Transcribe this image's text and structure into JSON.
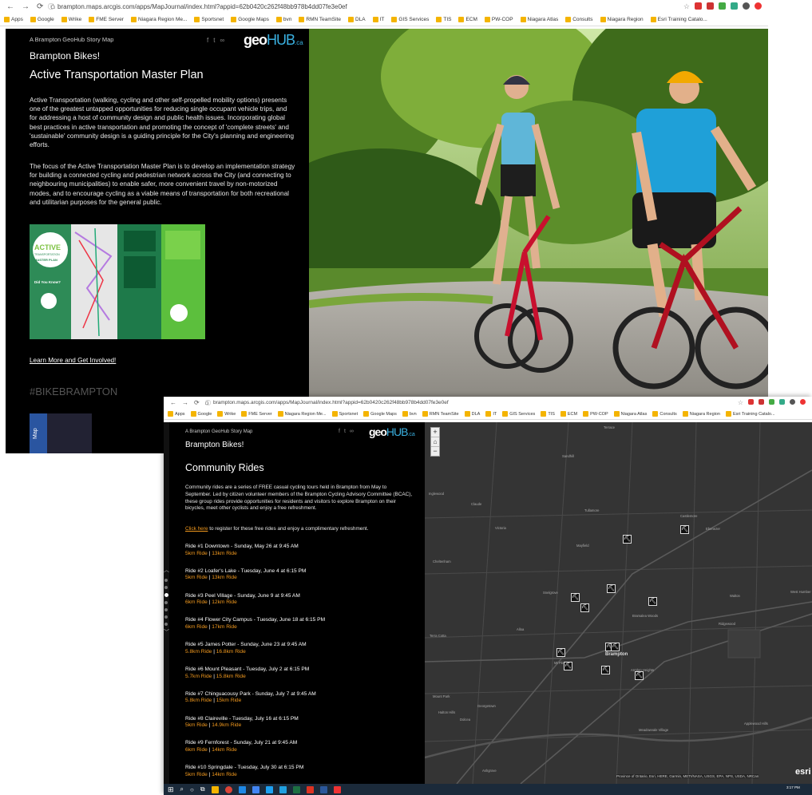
{
  "window1": {
    "url": "brampton.maps.arcgis.com/apps/MapJournal/index.html?appid=62b0420c262f48bb978b4dd07fe3e0ef",
    "bookmarks": [
      "Apps",
      "Google",
      "Wrike",
      "FME Server",
      "Niagara Region Me...",
      "Sportsnet",
      "Google Maps",
      "bvn",
      "RMN TeamSite",
      "DLA",
      "IT",
      "GIS Services",
      "TIS",
      "ECM",
      "PW-COP",
      "Niagara Atlas",
      "Consults",
      "Niagara Region",
      "Esri Training Catalo..."
    ],
    "panel": {
      "kicker": "A Brampton GeoHub Story Map",
      "app_title": "Brampton Bikes!",
      "logo_text_a": "geo",
      "logo_text_b": "HUB",
      "logo_text_c": ".ca",
      "section_title": "Active Transportation Master Plan",
      "para1": "Active Transportation (walking, cycling and other self-propelled mobility options) presents one of the greatest untapped opportunities for reducing single occupant vehicle trips, and for addressing a host of community design and public health issues. Incorporating global best practices in active transportation and promoting the concept of 'complete streets' and 'sustainable' community design is a guiding principle for the City's planning and engineering efforts.",
      "para2": "The focus of the Active Transportation Master Plan is to develop an implementation strategy for building a connected cycling and pedestrian network across the City (and connecting to neighbouring municipalities) to enable safer, more convenient travel by non-motorized modes, and to encourage cycling as a viable means of transportation for both recreational and utilitarian purposes for the general public.",
      "brochure_label_1": "ACTIVE",
      "brochure_label_2": "TRANSPORTATION",
      "brochure_label_3": "MASTER PLAN",
      "brochure_label_4": "Did You Know?",
      "link": "Learn More and Get Involved!",
      "hashtag": "#BIKEBRAMPTON",
      "map_tab": "Map"
    }
  },
  "window2": {
    "url": "brampton.maps.arcgis.com/apps/MapJournal/index.html?appid=62b0420c262f48bb978b4dd07fe3e0ef",
    "bookmarks": [
      "Apps",
      "Google",
      "Wrike",
      "FME Server",
      "Niagara Region Me...",
      "Sportsnet",
      "Google Maps",
      "bvn",
      "RMN TeamSite",
      "DLA",
      "IT",
      "GIS Services",
      "TIS",
      "ECM",
      "PW-COP",
      "Niagara Atlas",
      "Consults",
      "Niagara Region",
      "Esri Training Catalo..."
    ],
    "panel": {
      "kicker": "A Brampton GeoHub Story Map",
      "app_title": "Brampton Bikes!",
      "logo_text_a": "geo",
      "logo_text_b": "HUB",
      "logo_text_c": ".ca",
      "section_title": "Community Rides",
      "intro": "Community rides are a series of FREE casual cycling tours held in Brampton from May to September. Led by citizen volunteer members of the Brampton Cycling Advisory Committee (BCAC), these group rides provide opportunities for residents and visitors to explore Brampton on their bicycles, meet other cyclists and enjoy a free refreshment.",
      "click_link": "Click here",
      "click_rest": " to register for these free rides and enjoy a complimentary refreshment.",
      "rides": [
        {
          "title": "Ride #1 Downtown - Sunday, May 26 at 9:45 AM",
          "a": "5km Ride",
          "b": "13km Ride"
        },
        {
          "title": "Ride #2 Loafer's Lake - Tuesday, June 4 at 6:15 PM",
          "a": "5km Ride",
          "b": "13km Ride"
        },
        {
          "title": "Ride #3 Peel Village - Sunday, June 9 at 9:45 AM",
          "a": "6km Ride",
          "b": "12km Ride"
        },
        {
          "title": "Ride #4 Flower City Campus - Tuesday, June 18 at 6:15 PM",
          "a": "6km Ride",
          "b": "17km Ride"
        },
        {
          "title": "Ride #5 James Potter - Sunday, June 23 at 9:45 AM",
          "a": "5.8km Ride",
          "b": "16.8km Ride"
        },
        {
          "title": "Ride #6 Mount Pleasant - Tuesday, July 2 at 6:15 PM",
          "a": "5.7km Ride",
          "b": "15.8km Ride"
        },
        {
          "title": "Ride #7 Chinguacousy Park - Sunday, July 7 at 9:45 AM",
          "a": "5.8km Ride",
          "b": "15km Ride"
        },
        {
          "title": "Ride #8 Claireville - Tuesday, July 16 at 6:15 PM",
          "a": "5km Ride",
          "b": "14.9km Ride"
        },
        {
          "title": "Ride #9 Fernforest - Sunday, July 21 at 9:45 AM",
          "a": "6km Ride",
          "b": "14km Ride"
        },
        {
          "title": "Ride #10 Springdale - Tuesday, July 30 at 6:15 PM",
          "a": "5km Ride",
          "b": "14km Ride"
        }
      ],
      "separator": " | "
    },
    "map": {
      "attribution": "Province of Ontario, Esri, HERE, Garmin, METI/NASA, USGS, EPA, NPS, USDA, NRCan",
      "esri_logo": "esri",
      "clock": "3:17 PM",
      "places": [
        "Terrace",
        "Sandhill",
        "Inglewood",
        "Claude",
        "Tullamore",
        "Castlemore",
        "Victoria",
        "Mayfield",
        "Ebenezer",
        "Cheltenham",
        "Snelgrove",
        "Bramalea Woods",
        "Walton",
        "West Humber Estates",
        "Terra Cotta",
        "Ridgewood",
        "Alloa",
        "Brampton",
        "Mt Pleasant",
        "Armbro Heights",
        "Mount Park",
        "Georgetown",
        "Halton Hills",
        "Dolcea",
        "Meadowvale Village",
        "Applewood Hills",
        "Ashgrove"
      ]
    }
  }
}
